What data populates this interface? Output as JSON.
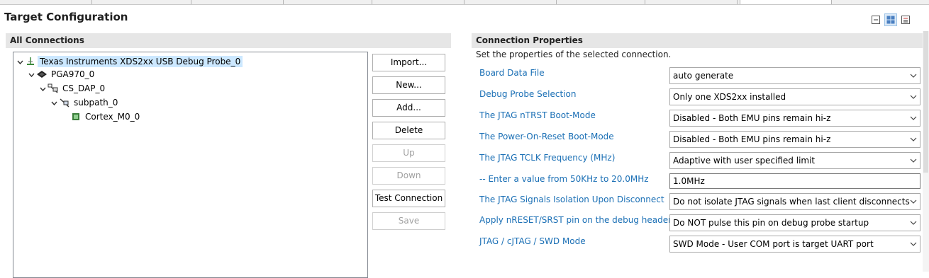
{
  "page_title": "Target Configuration",
  "left": {
    "header": "All Connections",
    "tree": [
      {
        "label": "Texas Instruments XDS2xx USB Debug Probe_0",
        "icon": "probe-icon",
        "selected": true
      },
      {
        "label": "PGA970_0",
        "icon": "chip-icon"
      },
      {
        "label": "CS_DAP_0",
        "icon": "dap-icon"
      },
      {
        "label": "subpath_0",
        "icon": "subpath-icon"
      },
      {
        "label": "Cortex_M0_0",
        "icon": "cpu-icon"
      }
    ],
    "buttons": {
      "import": "Import...",
      "new": "New...",
      "add": "Add...",
      "delete": "Delete",
      "up": "Up",
      "down": "Down",
      "test": "Test Connection",
      "save": "Save"
    }
  },
  "right": {
    "header": "Connection Properties",
    "subtitle": "Set the properties of the selected connection.",
    "properties": [
      {
        "label": "Board Data File",
        "value": "auto generate"
      },
      {
        "label": "Debug Probe Selection",
        "value": "Only one XDS2xx installed"
      },
      {
        "label": "The JTAG nTRST Boot-Mode",
        "value": "Disabled - Both EMU pins remain hi-z"
      },
      {
        "label": "The Power-On-Reset Boot-Mode",
        "value": "Disabled - Both EMU pins remain hi-z"
      },
      {
        "label": "The JTAG TCLK Frequency (MHz)",
        "value": "Adaptive with user specified limit"
      },
      {
        "label": "-- Enter a value from 50KHz to 20.0MHz",
        "value": "1.0MHz"
      },
      {
        "label": "The JTAG Signals Isolation Upon Disconnect",
        "value": "Do not isolate JTAG signals when last client disconnects"
      },
      {
        "label": "Apply nRESET/SRST pin on the debug header",
        "value": "Do NOT pulse this pin on debug probe startup"
      },
      {
        "label": "JTAG / cJTAG / SWD Mode",
        "value": "SWD Mode - User COM port is target UART port"
      }
    ]
  },
  "colors": {
    "link": "#1a6fb5",
    "selection": "#cce8ff",
    "header_bg": "#e6e6e6"
  }
}
